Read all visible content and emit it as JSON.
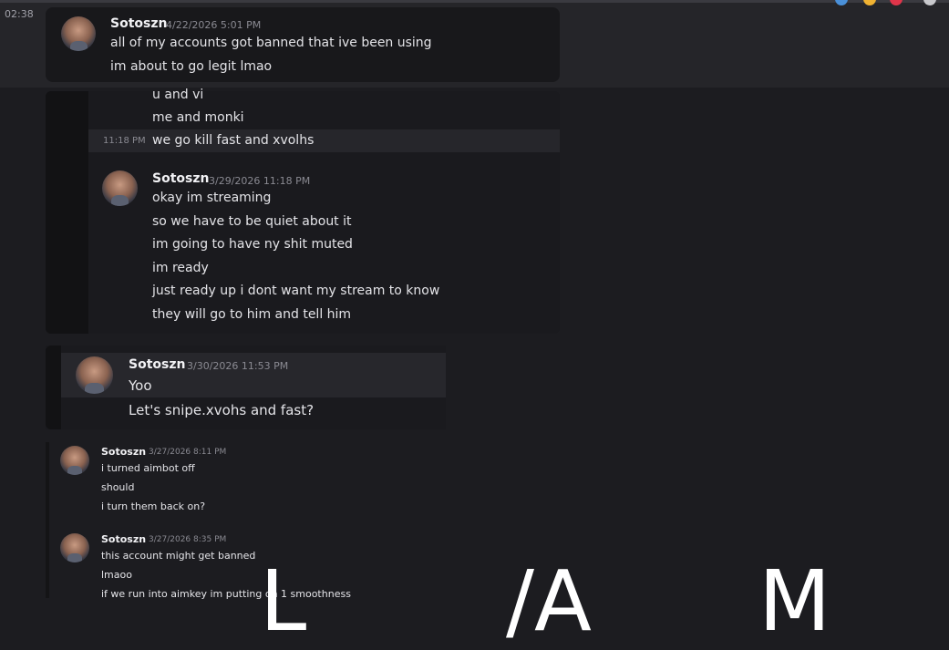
{
  "corner_time": "02:38",
  "messages_block1": {
    "author": "Sotoszn",
    "timestamp": "4/22/2026 5:01 PM",
    "lines": [
      "all of my accounts got banned that ive been using",
      "im about to go legit lmao"
    ]
  },
  "messages_block2": {
    "prior_lines": [
      "u and vi",
      "me and monki",
      "we go kill fast and xvolhs"
    ],
    "prior_time": "11:18 PM",
    "author": "Sotoszn",
    "timestamp": "3/29/2026 11:18 PM",
    "lines": [
      "okay im streaming",
      "so we have to be quiet about it",
      "im going to have ny shit muted",
      "im ready",
      "just ready up i dont want my stream to know",
      "they will go to him and tell him"
    ]
  },
  "messages_block3": {
    "author": "Sotoszn",
    "timestamp": "3/30/2026 11:53 PM",
    "lines": [
      "Yoo",
      "Let's snipe.xvohs and fast?"
    ]
  },
  "messages_block4": {
    "author": "Sotoszn",
    "timestamp": "3/27/2026 8:11 PM",
    "lines": [
      "i turned aimbot off",
      "should",
      "i turn them back on?"
    ]
  },
  "messages_block5": {
    "author": "Sotoszn",
    "timestamp": "3/27/2026 8:35 PM",
    "lines": [
      "this account might get banned",
      "lmaoo",
      "if we run into aimkey im putting on 1 smoothness"
    ]
  },
  "watermark": {
    "c1": "L",
    "c2": "/A",
    "c3": "M"
  },
  "colors": {
    "background": "#1c1c20",
    "card": "#18181b",
    "highlight": "#26262b",
    "text": "#e4e4e8",
    "muted": "#8a8a92"
  }
}
